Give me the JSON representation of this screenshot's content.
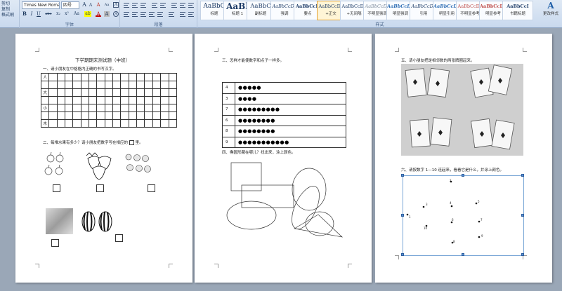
{
  "ribbon": {
    "clipboard": {
      "cut": "剪切",
      "copy": "复制",
      "format_painter": "格式刷"
    },
    "font": {
      "family": "Times New Roman",
      "size": "四号",
      "grow": "A",
      "shrink": "A",
      "clear": "A",
      "bold": "B",
      "italic": "I",
      "underline": "U",
      "strike": "abe",
      "sub": "x₂",
      "sup": "x²",
      "change_case": "Aa",
      "highlight": "ab",
      "color": "A",
      "border": "A",
      "group_label": "字体"
    },
    "paragraph": {
      "group_label": "段落"
    },
    "styles": {
      "group_label": "样式",
      "items": [
        {
          "sample": "AaBbC",
          "name": "标题"
        },
        {
          "sample": "AaBl",
          "name": "标题 1"
        },
        {
          "sample": "AaBbC",
          "name": "副标题"
        },
        {
          "sample": "AaBbCcDc",
          "name": "强调"
        },
        {
          "sample": "AaBbCcD",
          "name": "要点"
        },
        {
          "sample": "AaBbCcDc",
          "name": "+正文"
        },
        {
          "sample": "AaBbCcDc",
          "name": "+无间隔"
        },
        {
          "sample": "AaBbCcDc",
          "name": "不明显强调"
        },
        {
          "sample": "AaBbCcDc",
          "name": "明显强调"
        },
        {
          "sample": "AaBbCcDc",
          "name": "引用"
        },
        {
          "sample": "AaBbCcDc",
          "name": "明显引用"
        },
        {
          "sample": "AaBbCcDc",
          "name": "不明显参考"
        },
        {
          "sample": "AaBbCcDc",
          "name": "明显参考"
        },
        {
          "sample": "AaBbCcI",
          "name": "书籍标题"
        }
      ],
      "change_styles": "更改样式"
    }
  },
  "page1": {
    "title": "下学期期末测试题（中班）",
    "q1": "一、请小朋友在中格格内正确的书写汉字。",
    "rows": [
      "人",
      "大",
      "",
      "小",
      "",
      "木"
    ],
    "q2": "二、每堆水果有多少？请小朋友把数字写在相应的",
    "q2_tail": "里。"
  },
  "page2": {
    "q3": "三、怎样才能使数字和点子一样多。",
    "dot_rows": [
      {
        "n": "4",
        "dots": "●●●●●"
      },
      {
        "n": "3",
        "dots": "●●●●"
      },
      {
        "n": "7",
        "dots": "●●●●●●●●●"
      },
      {
        "n": "6",
        "dots": "●●●●●●●●"
      },
      {
        "n": "8",
        "dots": "●●●●●●●●"
      },
      {
        "n": "9",
        "dots": "●●●●●●●●●●●"
      }
    ],
    "q4": "四、椭圆形藏在哪儿？找出来，涂上颜色。"
  },
  "page3": {
    "q5": "五、请小朋友把是相邻数的两张牌圈起来。",
    "q6": "六、请按数字 1—10 连起来，看看它是什么，并涂上颜色。",
    "dot_numbers": [
      "1",
      "2",
      "3",
      "4",
      "5",
      "6",
      "7",
      "8",
      "9",
      "10"
    ]
  }
}
